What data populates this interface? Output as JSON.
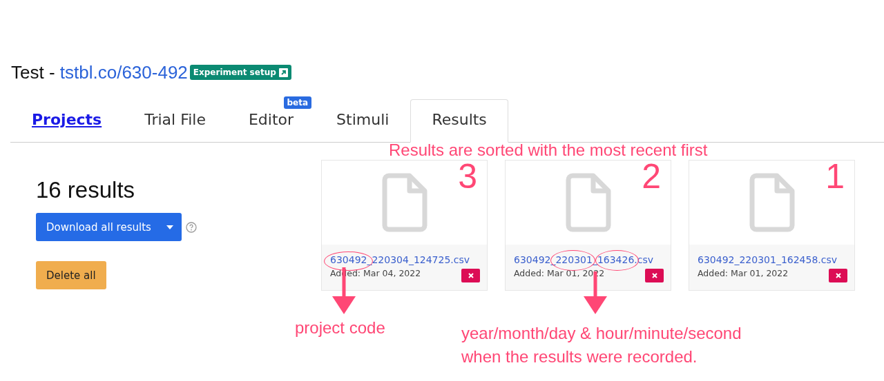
{
  "header": {
    "title": "Test - ",
    "link": "tstbl.co/630-492",
    "badge": "Experiment setup"
  },
  "tabs": [
    {
      "label": "Projects",
      "kind": "link",
      "selected": false
    },
    {
      "label": "Trial File",
      "kind": "tab",
      "selected": false
    },
    {
      "label": "Editor",
      "kind": "tab",
      "selected": false,
      "badge": "beta"
    },
    {
      "label": "Stimuli",
      "kind": "tab",
      "selected": false
    },
    {
      "label": "Results",
      "kind": "tab",
      "selected": true
    }
  ],
  "summary": {
    "count": "16 results",
    "download_button": "Download all results",
    "delete_button": "Delete all"
  },
  "results": [
    {
      "file": "630492_220304_124725.csv",
      "added": "Added: Mar 04, 2022",
      "rank": "3"
    },
    {
      "file": "630492_220301_163426.csv",
      "added": "Added: Mar 01, 2022",
      "rank": "2"
    },
    {
      "file": "630492_220301_162458.csv",
      "added": "Added: Mar 01, 2022",
      "rank": "1"
    }
  ],
  "annotations": {
    "sort_note": "Results are sorted with the most recent first",
    "project_code_note": "project code",
    "timestamp_note": [
      "year/month/day & hour/minute/second",
      "when the results were recorded."
    ]
  }
}
